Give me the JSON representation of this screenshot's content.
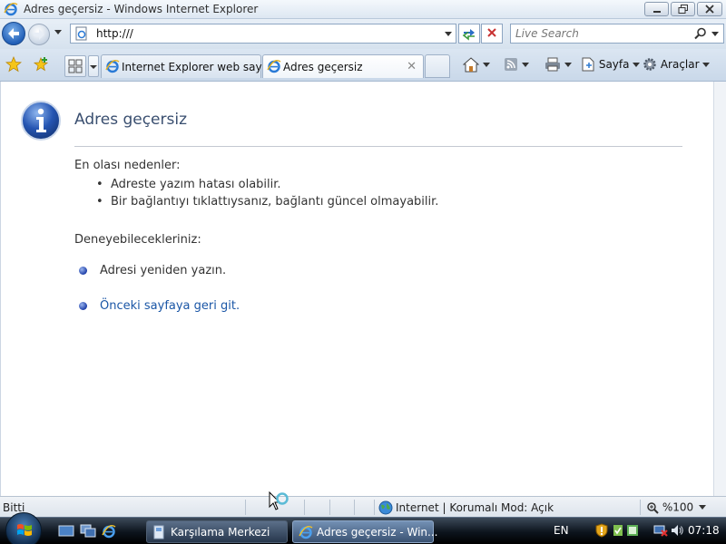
{
  "window": {
    "title": "Adres geçersiz - Windows Internet Explorer"
  },
  "address_bar": {
    "url": "http:///",
    "search_placeholder": "Live Search"
  },
  "tabs": [
    {
      "label": "Internet Explorer web sayfa...",
      "active": false
    },
    {
      "label": "Adres geçersiz",
      "active": true
    }
  ],
  "command_bar": {
    "page_label": "Sayfa",
    "tools_label": "Araçlar"
  },
  "content": {
    "title": "Adres geçersiz",
    "likely_causes_heading": "En olası nedenler:",
    "likely_causes": [
      "Adreste yazım hatası olabilir.",
      "Bir bağlantıyı tıklattıysanız, bağlantı güncel olmayabilir."
    ],
    "try_heading": "Deneyebilecekleriniz:",
    "try_items": [
      {
        "text": "Adresi yeniden yazın.",
        "link": false
      },
      {
        "text": "Önceki sayfaya geri git.",
        "link": true
      }
    ]
  },
  "status_bar": {
    "status": "Bitti",
    "zone": "Internet | Korumalı Mod: Açık",
    "zoom": "%100"
  },
  "taskbar": {
    "tasks": [
      {
        "label": "Karşılama Merkezi"
      },
      {
        "label": "Adres geçersiz - Win..."
      }
    ],
    "language": "EN",
    "clock": "07:18"
  },
  "colors": {
    "accent": "#2260b8",
    "link": "#1a56a6",
    "title_text": "#3a4f70"
  }
}
